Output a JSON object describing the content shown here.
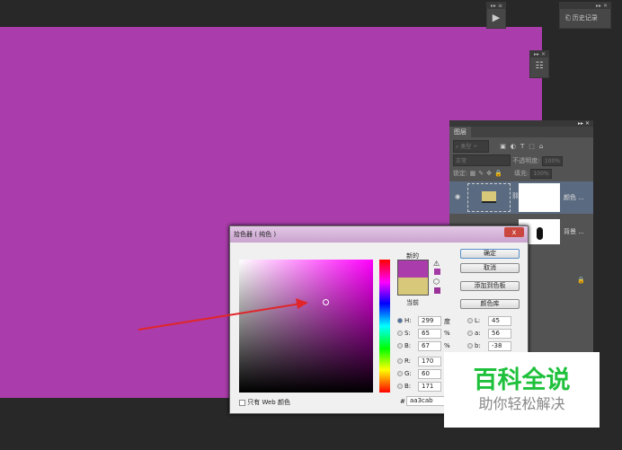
{
  "canvas": {
    "color": "#aa3cab"
  },
  "panels": {
    "history_label": "历史记录",
    "play_icon": "play-icon"
  },
  "layers": {
    "tab": "图层",
    "filter": "类型",
    "blend": "正常",
    "opacity_label": "不透明度:",
    "opacity": "100%",
    "lock_label": "锁定:",
    "fill_label": "填充:",
    "fill": "100%",
    "items": [
      {
        "name": "颜色 ...",
        "swatch": "#d8c97a"
      },
      {
        "name": "背景 ..."
      }
    ]
  },
  "dialog": {
    "title": "拾色器 ( 纯色 )",
    "close": "x",
    "new_label": "新的",
    "current_label": "当前",
    "new_color": "#aa3cab",
    "current_color": "#d8c97a",
    "ok": "确定",
    "cancel": "取消",
    "add_swatch": "添加到色板",
    "libraries": "颜色库",
    "fields": {
      "H": "299",
      "S": "65",
      "B": "67",
      "R": "170",
      "G": "60",
      "B2": "171",
      "L": "45",
      "a": "56",
      "b": "-38"
    },
    "labels": {
      "H": "H:",
      "S": "S:",
      "B": "B:",
      "R": "R:",
      "G": "G:",
      "B2": "B:",
      "L": "L:",
      "a": "a:",
      "b": "b:"
    },
    "units": {
      "deg": "度",
      "pct": "%"
    },
    "web_only": "只有 Web 颜色",
    "hash": "#",
    "hex": "aa3cab"
  },
  "watermark": {
    "title": "百科全说",
    "subtitle": "助你轻松解决"
  }
}
